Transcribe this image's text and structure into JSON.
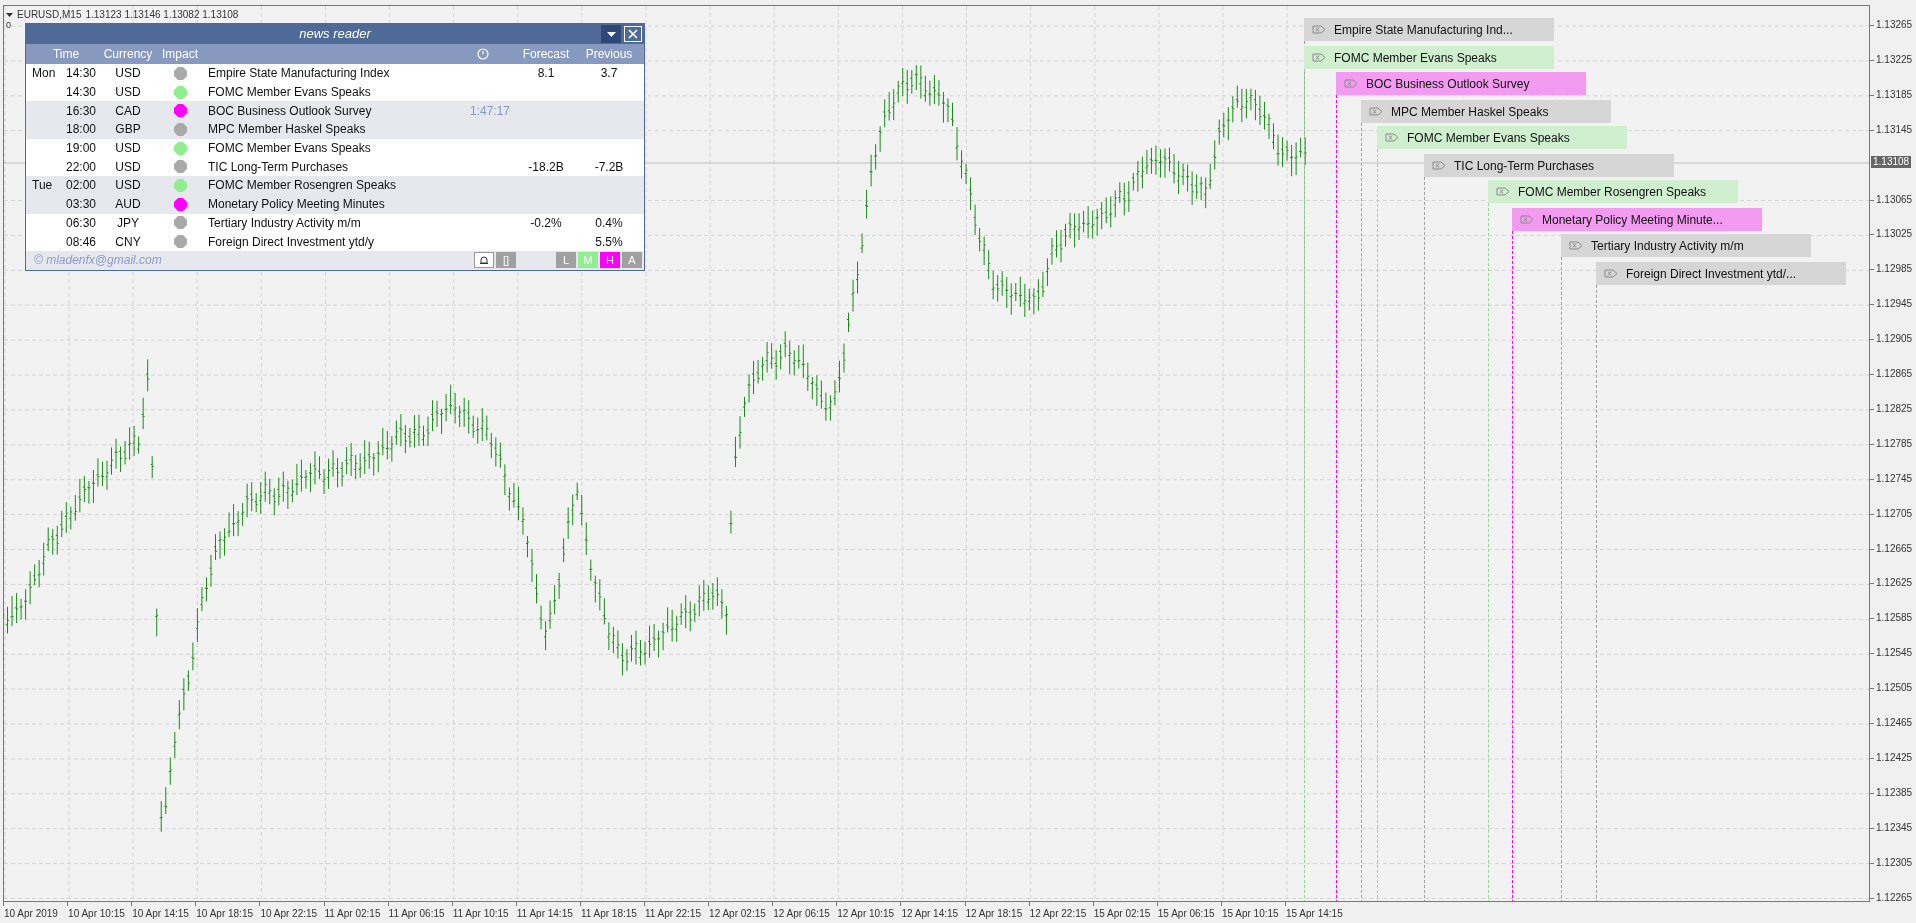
{
  "chart_header": {
    "symbol": "EURUSD,M15",
    "quotes": "1.13123 1.13146 1.13082 1.13108",
    "subwindow_label": "0"
  },
  "news_reader": {
    "title": "news reader",
    "columns": {
      "time": "Time",
      "currency": "Currency",
      "impact": "Impact",
      "forecast": "Forecast",
      "previous": "Previous"
    },
    "rows": [
      {
        "day": "Mon",
        "time": "14:30",
        "currency": "USD",
        "color": "#a9a9a9",
        "event": "Empire State Manufacturing Index",
        "forecast": "8.1",
        "previous": "3.7",
        "highlighted": false
      },
      {
        "time": "14:30",
        "currency": "USD",
        "color": "#90ee90",
        "event": "FOMC Member Evans Speaks",
        "highlighted": false
      },
      {
        "time": "16:30",
        "currency": "CAD",
        "color": "#ff00ff",
        "event": "BOC Business Outlook Survey",
        "countdown": "1:47:17",
        "highlighted": true
      },
      {
        "time": "18:00",
        "currency": "GBP",
        "color": "#a9a9a9",
        "event": "MPC Member Haskel Speaks",
        "highlighted": true
      },
      {
        "time": "19:00",
        "currency": "USD",
        "color": "#90ee90",
        "event": "FOMC Member Evans Speaks",
        "highlighted": false
      },
      {
        "time": "22:00",
        "currency": "USD",
        "color": "#a9a9a9",
        "event": "TIC Long-Term Purchases",
        "forecast": "-18.2B",
        "previous": "-7.2B",
        "highlighted": false
      },
      {
        "day": "Tue",
        "time": "02:00",
        "currency": "USD",
        "color": "#90ee90",
        "event": "FOMC Member Rosengren Speaks",
        "highlighted": true
      },
      {
        "time": "03:30",
        "currency": "AUD",
        "color": "#ff00ff",
        "event": "Monetary Policy Meeting Minutes",
        "highlighted": true
      },
      {
        "time": "06:30",
        "currency": "JPY",
        "color": "#a9a9a9",
        "event": "Tertiary Industry Activity m/m",
        "forecast": "-0.2%",
        "previous": "0.4%",
        "highlighted": false
      },
      {
        "time": "08:46",
        "currency": "CNY",
        "color": "#a9a9a9",
        "event": "Foreign Direct Investment ytd/y",
        "previous": "5.5%",
        "highlighted": false
      }
    ],
    "credit": "© mladenfx@gmail.com",
    "window_button": "[]",
    "filters": [
      {
        "label": "L",
        "color": "#a0a0a0"
      },
      {
        "label": "M",
        "color": "#90ee90"
      },
      {
        "label": "H",
        "color": "#ff00ff"
      },
      {
        "label": "A",
        "color": "#a0a0a0"
      }
    ]
  },
  "event_markers": [
    {
      "label": "Empire State Manufacturing Ind...",
      "color": "#d6d6d6"
    },
    {
      "label": "FOMC Member Evans Speaks",
      "color": "#cfefcf"
    },
    {
      "label": "BOC Business Outlook Survey",
      "color": "#f29bf0"
    },
    {
      "label": "MPC Member Haskel Speaks",
      "color": "#d6d6d6"
    },
    {
      "label": "FOMC Member Evans Speaks",
      "color": "#cfefcf"
    },
    {
      "label": "TIC Long-Term Purchases",
      "color": "#d6d6d6"
    },
    {
      "label": "FOMC Member Rosengren Speaks",
      "color": "#cfefcf"
    },
    {
      "label": "Monetary Policy Meeting Minute...",
      "color": "#f29bf0"
    },
    {
      "label": "Tertiary Industry Activity m/m",
      "color": "#d6d6d6"
    },
    {
      "label": "Foreign Direct Investment ytd/...",
      "color": "#d6d6d6"
    }
  ],
  "price_axis": {
    "labels": [
      "1.13265",
      "1.13225",
      "1.13185",
      "1.13145",
      "1.13065",
      "1.13025",
      "1.12985",
      "1.12945",
      "1.12905",
      "1.12865",
      "1.12825",
      "1.12785",
      "1.12745",
      "1.12705",
      "1.12665",
      "1.12625",
      "1.12585",
      "1.12545",
      "1.12505",
      "1.12465",
      "1.12425",
      "1.12385",
      "1.12345",
      "1.12305",
      "1.12265"
    ],
    "current_price": "1.13108"
  },
  "time_axis": {
    "labels": [
      "10 Apr 2019",
      "10 Apr 10:15",
      "10 Apr 14:15",
      "10 Apr 18:15",
      "10 Apr 22:15",
      "11 Apr 02:15",
      "11 Apr 06:15",
      "11 Apr 10:15",
      "11 Apr 14:15",
      "11 Apr 18:15",
      "11 Apr 22:15",
      "12 Apr 02:15",
      "12 Apr 06:15",
      "12 Apr 10:15",
      "12 Apr 14:15",
      "12 Apr 18:15",
      "12 Apr 22:15",
      "15 Apr 02:15",
      "15 Apr 06:15",
      "15 Apr 10:15",
      "15 Apr 14:15"
    ]
  }
}
